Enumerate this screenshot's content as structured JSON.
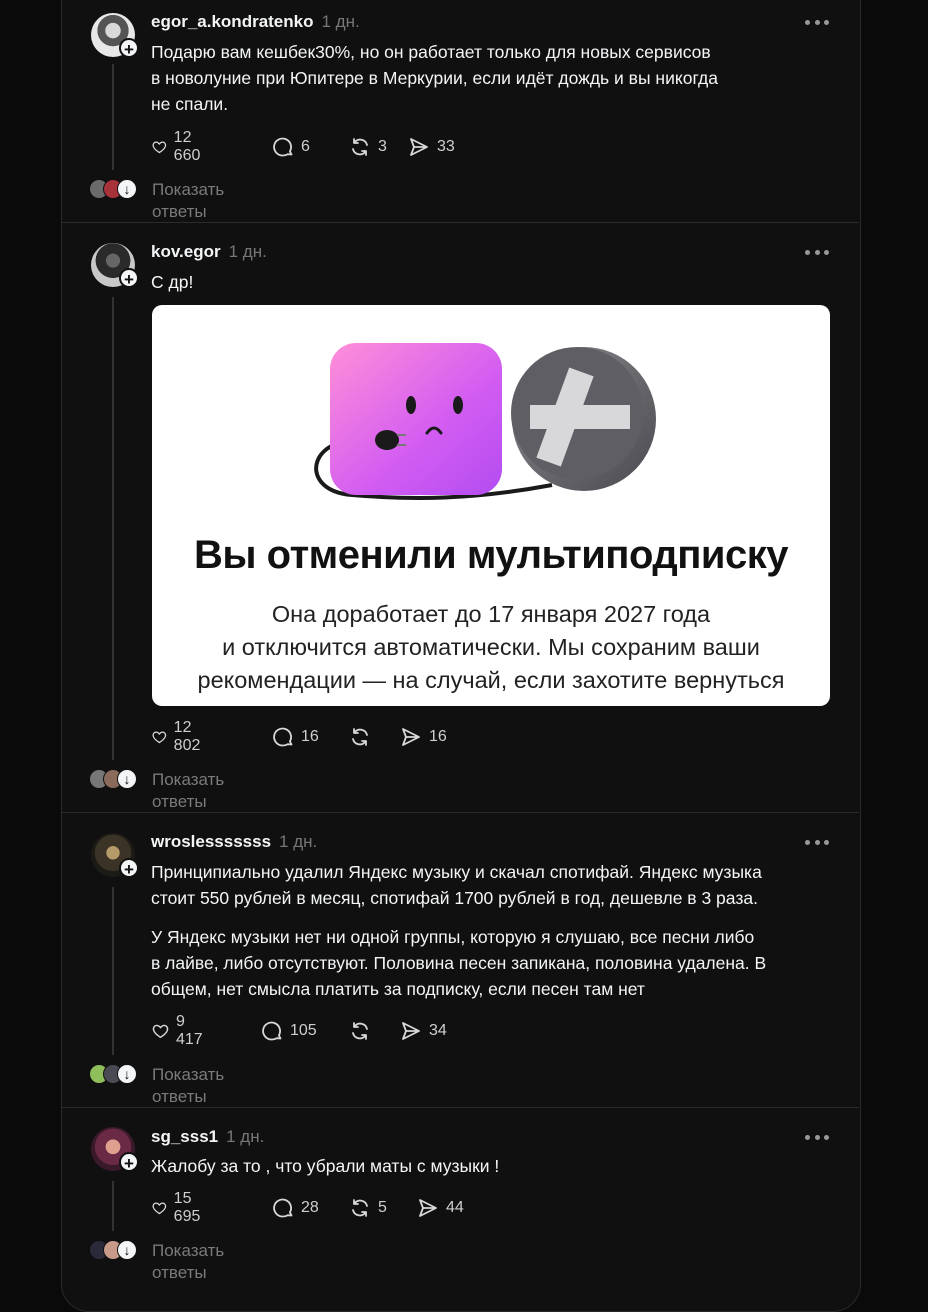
{
  "posts": [
    {
      "username": "egor_a.kondratenko",
      "time": "1 дн.",
      "text": "Подарю вам кешбек30%, но он работает только для новых сервисов\nв новолуние при Юпитере в Меркурии, если идёт дождь и вы никогда\nне спали.",
      "likes": "12 660",
      "comments": "6",
      "reposts": "3",
      "shares": "33",
      "show_replies": "Показать ответы"
    },
    {
      "username": "kov.egor",
      "time": "1 дн.",
      "text": "С др!",
      "likes": "12 802",
      "comments": "16",
      "reposts": "",
      "shares": "16",
      "show_replies": "Показать ответы",
      "image": {
        "title": "Вы отменили мультиподписку",
        "subtitle": "Она доработает до 17 января 2027 года\nи отключится автоматически. Мы сохраним ваши\nрекомендации — на случай, если захотите вернуться"
      }
    },
    {
      "username": "wroslesssssss",
      "time": "1 дн.",
      "text": "Принципиально удалил Яндекс музыку и скачал спотифай. Яндекс музыка\nстоит 550 рублей в месяц, спотифай 1700 рублей в год, дешевле в 3 раза.",
      "text2": "У Яндекс музыки нет ни одной группы, которую я слушаю, все песни либо\nв лайве, либо отсутствуют. Половина песен запикана, половина удалена. В\nобщем, нет смысла платить за подписку, если песен там нет",
      "likes": "9 417",
      "comments": "105",
      "reposts": "",
      "shares": "34",
      "show_replies": "Показать ответы"
    },
    {
      "username": "sg_sss1",
      "time": "1 дн.",
      "text": "Жалобу за то , что убрали маты с музыки !",
      "likes": "15 695",
      "comments": "28",
      "reposts": "5",
      "shares": "44",
      "show_replies": "Показать ответы"
    }
  ],
  "icons": {
    "like": "heart-icon",
    "comment": "comment-icon",
    "repost": "repost-icon",
    "share": "share-icon",
    "more": "more-icon",
    "follow": "plus-icon"
  },
  "colors": {
    "background": "#101010",
    "text": "#f3f5f7",
    "muted": "#777777",
    "card_gradient_start": "#ff7ad9",
    "card_gradient_end": "#a855f7"
  }
}
